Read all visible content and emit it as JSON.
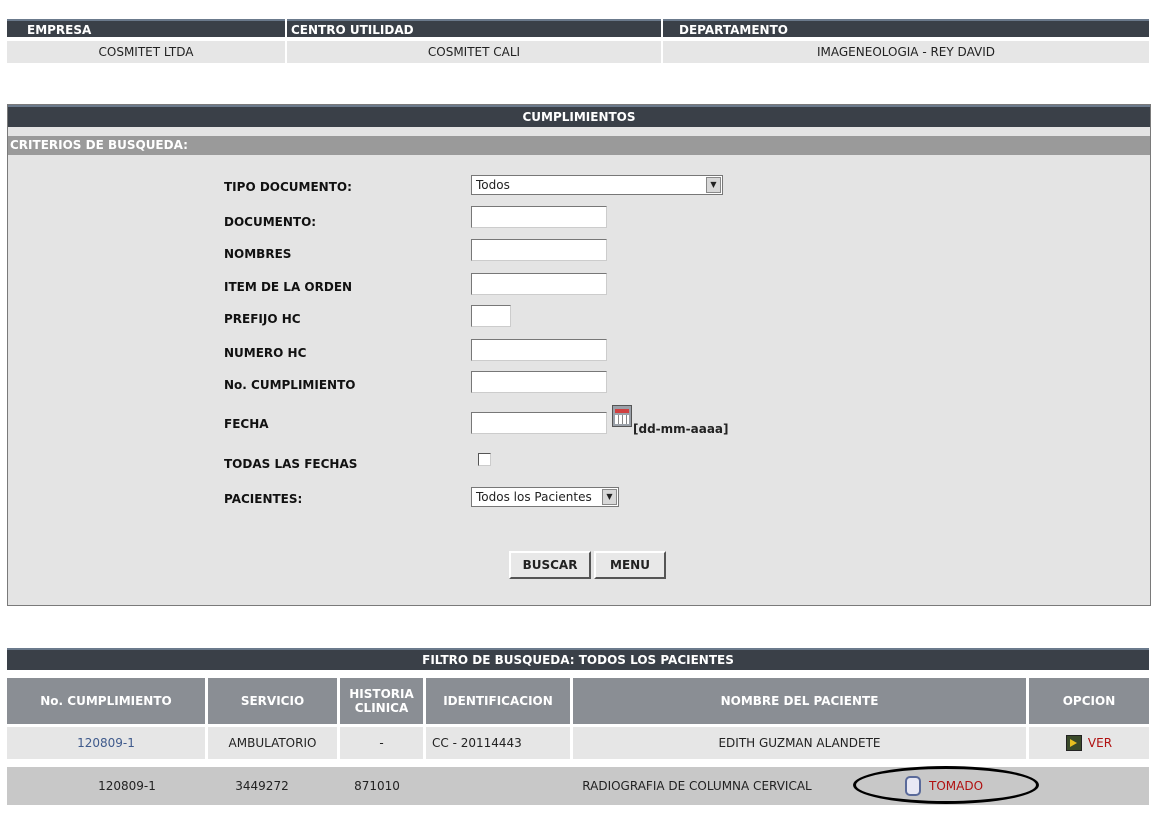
{
  "top_info": {
    "headers": [
      "EMPRESA",
      "CENTRO UTILIDAD",
      "DEPARTAMENTO"
    ],
    "values": [
      "COSMITET LTDA",
      "COSMITET CALI",
      "IMAGENEOLOGIA - REY DAVID"
    ]
  },
  "panel": {
    "title": "CUMPLIMIENTOS",
    "criteria_label": "CRITERIOS DE BUSQUEDA:",
    "fields": {
      "tipo_documento": {
        "label": "TIPO DOCUMENTO:",
        "value": "Todos"
      },
      "documento": {
        "label": "DOCUMENTO:",
        "value": ""
      },
      "nombres": {
        "label": "NOMBRES",
        "value": ""
      },
      "item_orden": {
        "label": "ITEM DE LA ORDEN",
        "value": ""
      },
      "prefijo_hc": {
        "label": "PREFIJO HC",
        "value": ""
      },
      "numero_hc": {
        "label": "NUMERO HC",
        "value": ""
      },
      "no_cumplimiento": {
        "label": "No. CUMPLIMIENTO",
        "value": ""
      },
      "fecha": {
        "label": "FECHA",
        "value": "",
        "format_hint": "[dd-mm-aaaa]"
      },
      "todas_fechas": {
        "label": "TODAS LAS FECHAS",
        "checked": false
      },
      "pacientes": {
        "label": "PACIENTES:",
        "value": "Todos los Pacientes"
      }
    },
    "buttons": {
      "buscar": "BUSCAR",
      "menu": "MENU"
    }
  },
  "results": {
    "title": "FILTRO DE BUSQUEDA: TODOS LOS PACIENTES",
    "columns": [
      "No. CUMPLIMIENTO",
      "SERVICIO",
      "HISTORIA CLINICA",
      "IDENTIFICACION",
      "NOMBRE DEL PACIENTE",
      "OPCION"
    ],
    "row": {
      "cumplimiento": "120809-1",
      "servicio": "AMBULATORIO",
      "historia": "-",
      "identificacion": "CC - 20114443",
      "nombre": "EDITH GUZMAN ALANDETE",
      "opcion": "VER"
    },
    "detail": {
      "cumplimiento": "120809-1",
      "code1": "3449272",
      "code2": "871010",
      "description": "RADIOGRAFIA DE COLUMNA CERVICAL",
      "status": "TOMADO"
    }
  },
  "colors": {
    "header_bg": "#3a4048",
    "subheader_bg": "#9a9a9a",
    "panel_bg": "#e4e4e4",
    "link": "#3f5a8c",
    "status_red": "#b01010"
  }
}
